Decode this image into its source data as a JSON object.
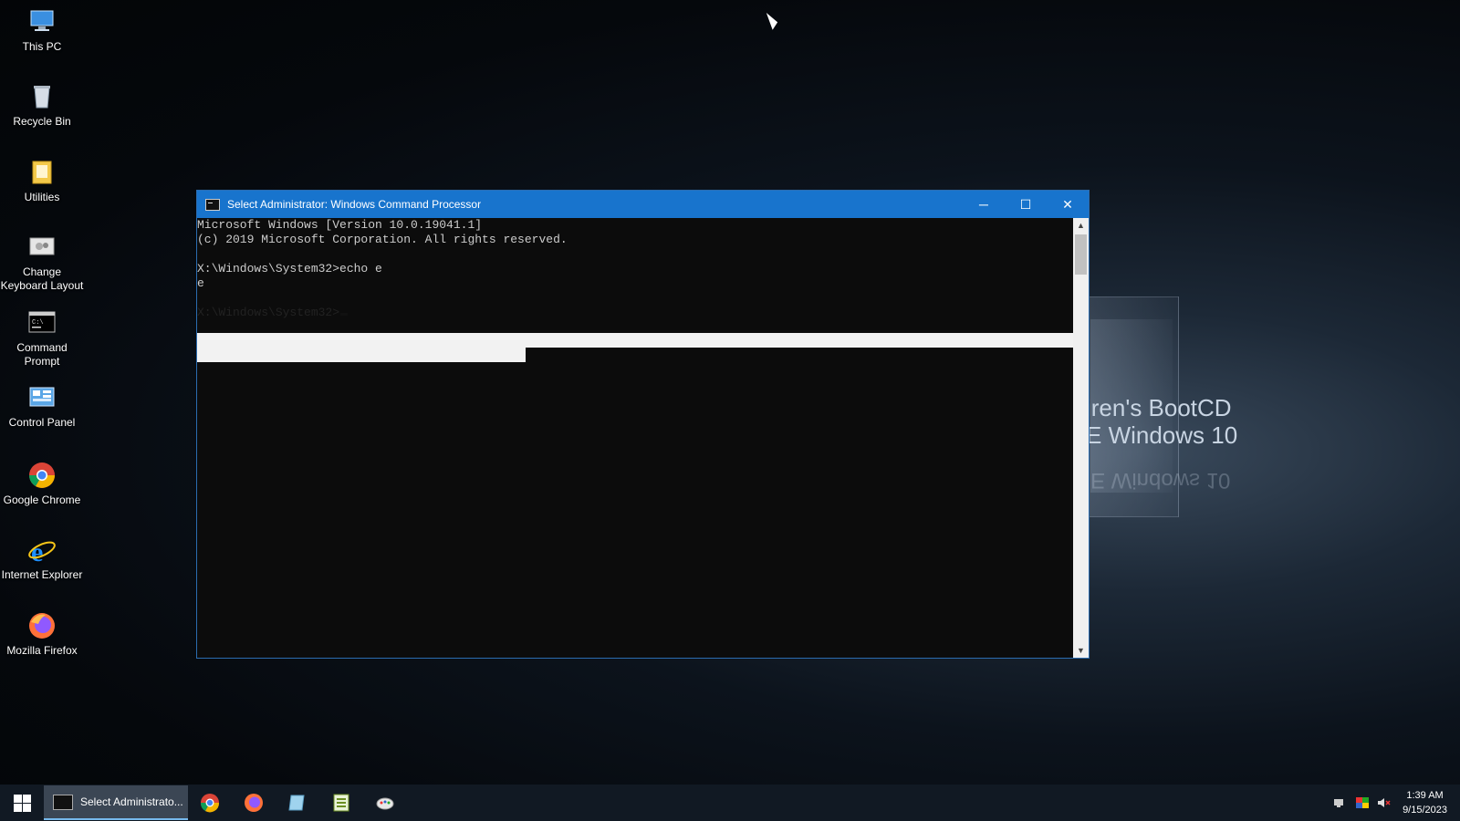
{
  "desktop": {
    "icons": [
      {
        "label": "This PC",
        "icon": "this-pc-icon"
      },
      {
        "label": "Recycle Bin",
        "icon": "recycle-bin-icon"
      },
      {
        "label": "Utilities",
        "icon": "folder-icon"
      },
      {
        "label": "Change Keyboard Layout",
        "icon": "keyboard-layout-icon"
      },
      {
        "label": "Command Prompt",
        "icon": "command-prompt-icon"
      },
      {
        "label": "Control Panel",
        "icon": "control-panel-icon"
      },
      {
        "label": "Google Chrome",
        "icon": "chrome-icon"
      },
      {
        "label": "Internet Explorer",
        "icon": "internet-explorer-icon"
      },
      {
        "label": "Mozilla Firefox",
        "icon": "firefox-icon"
      }
    ],
    "wallpaper": {
      "line1": "iren's BootCD",
      "line2": "E Windows 10",
      "reflection": "E Windows 10"
    }
  },
  "cmd_window": {
    "title": "Select Administrator: Windows Command Processor",
    "minimize": "─",
    "maximize": "☐",
    "close": "✕",
    "lines": [
      "Microsoft Windows [Version 10.0.19041.1]",
      "(c) 2019 Microsoft Corporation. All rights reserved.",
      "",
      "X:\\Windows\\System32>echo e",
      "e",
      "",
      "X:\\Windows\\System32>"
    ]
  },
  "taskbar": {
    "active_task": "Select Administrato...",
    "apps": [
      "chrome-icon",
      "firefox-icon",
      "notepad-icon",
      "spreadsheet-icon",
      "paint-icon"
    ],
    "clock": {
      "time": "1:39 AM",
      "date": "9/15/2023"
    }
  },
  "colors": {
    "titlebar": "#1874cd",
    "console_bg": "#0c0c0c",
    "taskbar": "#111923"
  }
}
